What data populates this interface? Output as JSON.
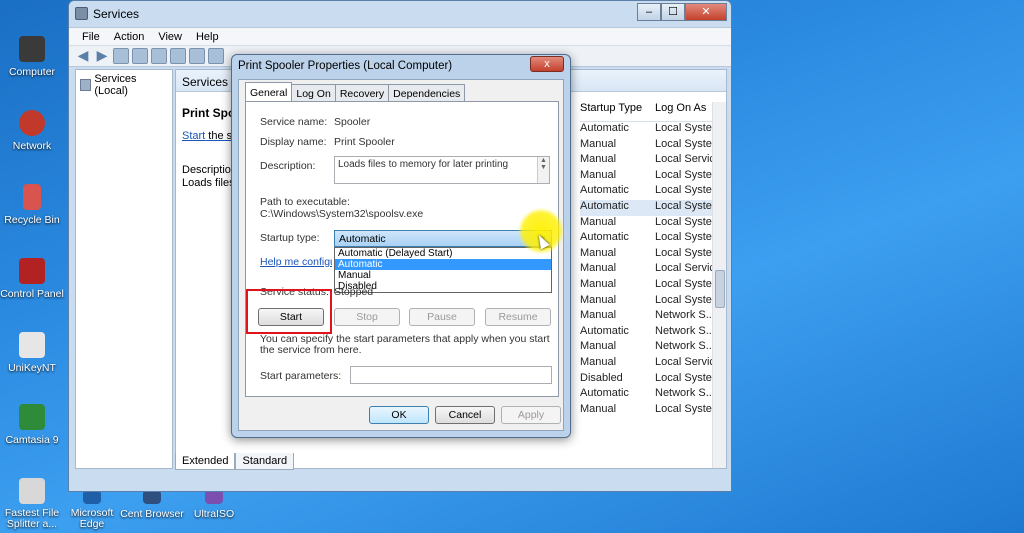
{
  "desktop": {
    "icons": [
      {
        "label": "Computer",
        "color": "#3a3a3a"
      },
      {
        "label": "Network",
        "color": "#c0392b"
      },
      {
        "label": "Recycle Bin",
        "color": "#d9534f"
      },
      {
        "label": "Control Panel",
        "color": "#b22222"
      },
      {
        "label": "UniKeyNT",
        "color": "#e6e6e6"
      },
      {
        "label": "Camtasia 9",
        "color": "#2e8b3a"
      },
      {
        "label": "Fastest File Splitter a...",
        "color": "#d8d8d8"
      }
    ],
    "taskbar_icons": [
      {
        "label": "Microsoft Edge"
      },
      {
        "label": "Cent Browser"
      },
      {
        "label": "UltraISO"
      }
    ]
  },
  "services_window": {
    "title": "Services",
    "menu": [
      "File",
      "Action",
      "View",
      "Help"
    ],
    "tree_root": "Services (Local)",
    "header": "Services",
    "selected_service_name": "Print Spooler",
    "start_link": "Start",
    "start_link_suffix": " the service",
    "description_label": "Description:",
    "description_text": "Loads files to memory for later printing",
    "columns": {
      "startup_type": "Startup Type",
      "log_on_as": "Log On As"
    },
    "rows": [
      {
        "startup": "Automatic",
        "logon": "Local Syste..."
      },
      {
        "startup": "Manual",
        "logon": "Local Syste..."
      },
      {
        "startup": "Manual",
        "logon": "Local Service"
      },
      {
        "startup": "Manual",
        "logon": "Local Syste..."
      },
      {
        "startup": "Automatic",
        "logon": "Local Syste..."
      },
      {
        "startup": "Automatic",
        "logon": "Local Syste..."
      },
      {
        "startup": "Manual",
        "logon": "Local Syste..."
      },
      {
        "startup": "Automatic",
        "logon": "Local Syste..."
      },
      {
        "startup": "Manual",
        "logon": "Local Syste..."
      },
      {
        "startup": "Manual",
        "logon": "Local Service"
      },
      {
        "startup": "Manual",
        "logon": "Local Syste..."
      },
      {
        "startup": "Manual",
        "logon": "Local Syste..."
      },
      {
        "startup": "Manual",
        "logon": "Network S..."
      },
      {
        "startup": "Automatic",
        "logon": "Network S..."
      },
      {
        "startup": "Manual",
        "logon": "Network S..."
      },
      {
        "startup": "Manual",
        "logon": "Local Service"
      },
      {
        "startup": "Disabled",
        "logon": "Local Syste..."
      },
      {
        "startup": "Automatic",
        "logon": "Network S..."
      },
      {
        "startup": "Manual",
        "logon": "Local Syste..."
      }
    ],
    "tabs": [
      "Extended",
      "Standard"
    ]
  },
  "dialog": {
    "title": "Print Spooler Properties (Local Computer)",
    "close": "x",
    "tabs": [
      "General",
      "Log On",
      "Recovery",
      "Dependencies"
    ],
    "service_name_label": "Service name:",
    "service_name": "Spooler",
    "display_name_label": "Display name:",
    "display_name": "Print Spooler",
    "description_label": "Description:",
    "description": "Loads files to memory for later printing",
    "path_label": "Path to executable:",
    "path": "C:\\Windows\\System32\\spoolsv.exe",
    "startup_type_label": "Startup type:",
    "startup_type_value": "Automatic",
    "startup_options": [
      "Automatic (Delayed Start)",
      "Automatic",
      "Manual",
      "Disabled"
    ],
    "help_link": "Help me configure",
    "service_status_label": "Service status:",
    "service_status": "Stopped",
    "buttons": {
      "start": "Start",
      "stop": "Stop",
      "pause": "Pause",
      "resume": "Resume"
    },
    "hint": "You can specify the start parameters that apply when you start the service from here.",
    "start_params_label": "Start parameters:",
    "start_params_value": "",
    "ok": "OK",
    "cancel": "Cancel",
    "apply": "Apply"
  },
  "colors": {
    "highlight": "#fff000",
    "annotation_box": "#e0131c",
    "selection": "#3399ff"
  }
}
